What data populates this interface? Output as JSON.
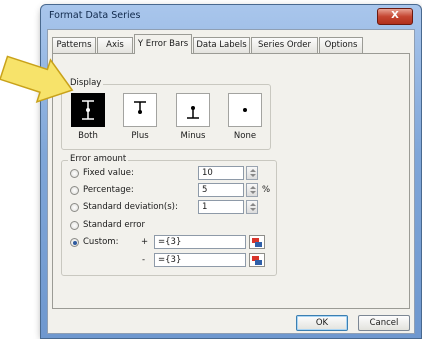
{
  "window": {
    "title": "Format Data Series",
    "close_label": "X"
  },
  "tabs": [
    {
      "label": "Patterns"
    },
    {
      "label": "Axis"
    },
    {
      "label": "Y Error Bars",
      "active": true
    },
    {
      "label": "Data Labels"
    },
    {
      "label": "Series Order"
    },
    {
      "label": "Options"
    }
  ],
  "display": {
    "group_label": "Display",
    "options": [
      {
        "label": "Both",
        "icon": "error-bar-both-icon",
        "selected": true
      },
      {
        "label": "Plus",
        "icon": "error-bar-plus-icon",
        "selected": false
      },
      {
        "label": "Minus",
        "icon": "error-bar-minus-icon",
        "selected": false
      },
      {
        "label": "None",
        "icon": "error-bar-none-icon",
        "selected": false
      }
    ]
  },
  "error_amount": {
    "group_label": "Error amount",
    "fixed_value": {
      "label": "Fixed value:",
      "value": "10",
      "checked": false
    },
    "percentage": {
      "label": "Percentage:",
      "value": "5",
      "unit": "%",
      "checked": false
    },
    "std_dev": {
      "label": "Standard deviation(s):",
      "value": "1",
      "checked": false
    },
    "std_error": {
      "label": "Standard error",
      "checked": false
    },
    "custom": {
      "label": "Custom:",
      "checked": true,
      "plus_sign": "+",
      "plus_value": "={3}",
      "minus_sign": "-",
      "minus_value": "={3}"
    }
  },
  "buttons": {
    "ok": "OK",
    "cancel": "Cancel"
  },
  "colors": {
    "title_bar": "#7fa6d8",
    "close_button": "#c54632",
    "dialog_bg": "#f2f1ec",
    "callout_arrow": "#f7e36a"
  }
}
